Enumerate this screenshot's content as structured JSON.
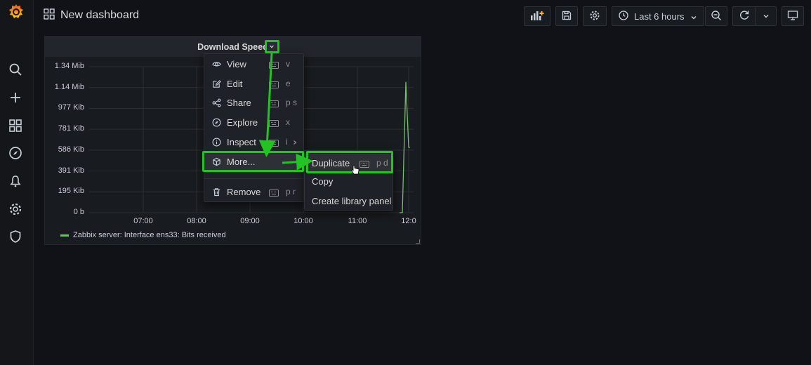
{
  "header": {
    "title": "New dashboard",
    "time_range": "Last 6 hours"
  },
  "panel": {
    "title": "Download Speed",
    "legend": "Zabbix server: Interface ens33: Bits received"
  },
  "chart_data": {
    "type": "line",
    "title": "Download Speed",
    "y_tick_labels": [
      "1.34 Mib",
      "1.14 Mib",
      "977 Kib",
      "781 Kib",
      "586 Kib",
      "391 Kib",
      "195 Kib",
      "0 b"
    ],
    "x_tick_labels": [
      "07:00",
      "08:00",
      "09:00",
      "10:00",
      "11:00",
      "12:0"
    ],
    "series": [
      {
        "name": "Zabbix server: Interface ens33: Bits received",
        "color": "#73bf69",
        "x": [
          "11:50",
          "11:52",
          "11:54",
          "11:56",
          "11:58"
        ],
        "values_mib": [
          0,
          0,
          1.2,
          0.6,
          0.6
        ]
      }
    ],
    "ylim_mib": [
      0,
      1.34
    ]
  },
  "panel_menu": {
    "items": [
      {
        "label": "View",
        "shortcut": "v",
        "icon": "eye-icon"
      },
      {
        "label": "Edit",
        "shortcut": "e",
        "icon": "edit-icon"
      },
      {
        "label": "Share",
        "shortcut": "p s",
        "icon": "share-icon"
      },
      {
        "label": "Explore",
        "shortcut": "x",
        "icon": "compass-icon"
      },
      {
        "label": "Inspect",
        "shortcut": "i",
        "icon": "info-icon"
      },
      {
        "label": "More...",
        "shortcut": "",
        "icon": "cube-icon"
      },
      {
        "label": "Remove",
        "shortcut": "p r",
        "icon": "trash-icon"
      }
    ]
  },
  "submenu": {
    "items": [
      {
        "label": "Duplicate",
        "shortcut": "p d"
      },
      {
        "label": "Copy",
        "shortcut": ""
      },
      {
        "label": "Create library panel",
        "shortcut": ""
      }
    ]
  },
  "colors": {
    "accent_green": "#22c322",
    "series_green": "#73bf69",
    "logo_orange": "#f05a28"
  }
}
